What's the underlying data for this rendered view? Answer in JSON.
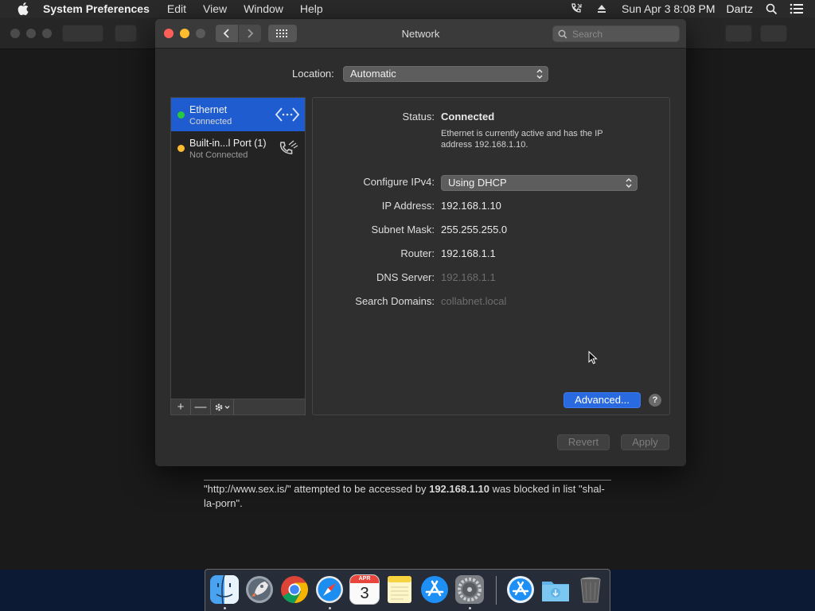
{
  "menubar": {
    "app_name": "System Preferences",
    "menus": [
      "Edit",
      "View",
      "Window",
      "Help"
    ],
    "clock": "Sun Apr 3  8:08 PM",
    "user": "Dartz"
  },
  "window": {
    "title": "Network",
    "search_placeholder": "Search"
  },
  "location": {
    "label": "Location:",
    "value": "Automatic"
  },
  "services": [
    {
      "name": "Ethernet",
      "status": "Connected",
      "dot_color": "#28c840",
      "selected": true
    },
    {
      "name": "Built-in...l Port (1)",
      "status": "Not Connected",
      "dot_color": "#febc2e",
      "selected": false
    }
  ],
  "sidebar_toolbar": {
    "add": "+",
    "remove": "—"
  },
  "detail": {
    "status_label": "Status:",
    "status_value": "Connected",
    "status_desc": "Ethernet is currently active and has the IP address 192.168.1.10.",
    "configure_label": "Configure IPv4:",
    "configure_value": "Using DHCP",
    "ip_label": "IP Address:",
    "ip_value": "192.168.1.10",
    "subnet_label": "Subnet Mask:",
    "subnet_value": "255.255.255.0",
    "router_label": "Router:",
    "router_value": "192.168.1.1",
    "dns_label": "DNS Server:",
    "dns_value": "192.168.1.1",
    "search_domains_label": "Search Domains:",
    "search_domains_value": "collabnet.local",
    "advanced_button": "Advanced...",
    "help_button": "?"
  },
  "buttons": {
    "revert": "Revert",
    "apply": "Apply"
  },
  "notice": {
    "part1": "\"http://www.sex.is/\" attempted to be accessed by ",
    "ip": "192.168.1.10",
    "part2": " was blocked in list \"shal-la-porn\"."
  },
  "dock": {
    "calendar_month": "APR",
    "calendar_day": "3",
    "apps": [
      "finder",
      "launchpad",
      "chrome",
      "safari",
      "calendar",
      "notes",
      "app-store",
      "system-preferences",
      "app-store-alt",
      "downloads-folder",
      "trash"
    ]
  },
  "colors": {
    "accent": "#1e5ccf",
    "button_blue": "#2a6ae0",
    "connected_green": "#28c840",
    "not_connected_yellow": "#febc2e"
  }
}
